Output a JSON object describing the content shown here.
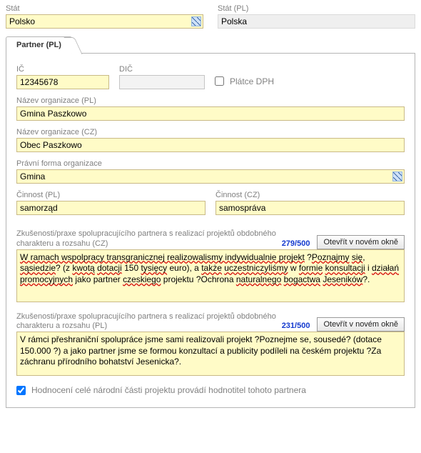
{
  "top": {
    "stat_label": "Stát",
    "stat_value": "Polsko",
    "stat_pl_label": "Stát (PL)",
    "stat_pl_value": "Polska"
  },
  "tab": {
    "active": "Partner (PL)"
  },
  "ids": {
    "ic_label": "IČ",
    "ic_value": "12345678",
    "dic_label": "DIČ",
    "dic_value": "",
    "vat_label": "Plátce DPH"
  },
  "org": {
    "name_pl_label": "Název organizace (PL)",
    "name_pl_value": "Gmina Paszkowo",
    "name_cz_label": "Název organizace (CZ)",
    "name_cz_value": "Obec Paszkowo",
    "legal_label": "Právní forma organizace",
    "legal_value": "Gmina"
  },
  "activity": {
    "pl_label": "Činnost (PL)",
    "pl_value": "samorząd",
    "cz_label": "Činnost (CZ)",
    "cz_value": "samospráva"
  },
  "exp_cz": {
    "label": "Zkušenosti/praxe spolupracujícího partnera s realizací projektů obdobného charakteru a rozsahu (CZ)",
    "counter": "279/500",
    "open_btn": "Otevřít v novém okně"
  },
  "exp_pl": {
    "label": "Zkušenosti/praxe spolupracujícího partnera s realizací projektů obdobného charakteru a rozsahu (PL)",
    "counter": "231/500",
    "open_btn": "Otevřít v novém okně",
    "text": "V rámci přeshraniční spolupráce jsme sami realizovali projekt ?Poznejme se, sousedé? (dotace 150.000 ?) a jako partner jsme se formou konzultací a publicity podíleli na českém projektu ?Za záchranu přírodního bohatství Jesenicka?."
  },
  "final": {
    "label": "Hodnocení celé národní části projektu provádí hodnotitel tohoto partnera"
  }
}
